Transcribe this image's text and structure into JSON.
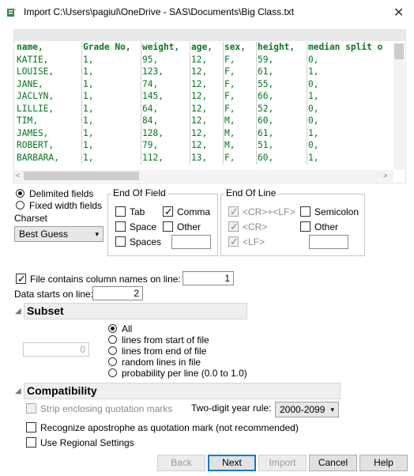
{
  "window": {
    "title": "Import C:\\Users\\pagiul\\OneDrive - SAS\\Documents\\Big Class.txt",
    "app_icon": "import-data-icon",
    "close_icon": "close-icon"
  },
  "preview": {
    "columns": [
      "name,",
      "Grade No,",
      "weight,",
      "age,",
      "sex,",
      "height,",
      "median split o"
    ],
    "rows": [
      [
        "KATIE,",
        "1,",
        "95,",
        "12,",
        "F,",
        "59,",
        "0,"
      ],
      [
        "LOUISE,",
        "1,",
        "123,",
        "12,",
        "F,",
        "61,",
        "1,"
      ],
      [
        "JANE,",
        "1,",
        "74,",
        "12,",
        "F,",
        "55,",
        "0,"
      ],
      [
        "JACLYN,",
        "1,",
        "145,",
        "12,",
        "F,",
        "66,",
        "1,"
      ],
      [
        "LILLIE,",
        "1,",
        "64,",
        "12,",
        "F,",
        "52,",
        "0,"
      ],
      [
        "TIM,",
        "1,",
        "84,",
        "12,",
        "M,",
        "60,",
        "0,"
      ],
      [
        "JAMES,",
        "1,",
        "128,",
        "12,",
        "M,",
        "61,",
        "1,"
      ],
      [
        "ROBERT,",
        "1,",
        "79,",
        "12,",
        "M,",
        "51,",
        "0,"
      ],
      [
        "BARBARA,",
        "1,",
        "112,",
        "13,",
        "F,",
        "60,",
        "1,"
      ]
    ],
    "text_color": "#007a1e"
  },
  "layout_mode": {
    "delimited_label": "Delimited fields",
    "fixed_label": "Fixed width fields",
    "selected": "delimited"
  },
  "charset": {
    "label": "Charset",
    "value": "Best Guess"
  },
  "end_of_field": {
    "title": "End Of Field",
    "tab": {
      "label": "Tab",
      "checked": false
    },
    "comma": {
      "label": "Comma",
      "checked": true
    },
    "space": {
      "label": "Space",
      "checked": false
    },
    "other": {
      "label": "Other",
      "checked": false
    },
    "spaces": {
      "label": "Spaces",
      "checked": false
    },
    "other_value": ""
  },
  "end_of_line": {
    "title": "End Of Line",
    "crlf": {
      "label": "<CR>+<LF>",
      "checked": true
    },
    "cr": {
      "label": "<CR>",
      "checked": true
    },
    "lf": {
      "label": "<LF>",
      "checked": true
    },
    "semicolon": {
      "label": "Semicolon",
      "checked": false
    },
    "other": {
      "label": "Other",
      "checked": false
    },
    "other_value": ""
  },
  "column_names": {
    "label": "File contains column names on line:",
    "checked": true,
    "value": "1"
  },
  "data_starts": {
    "label": "Data starts on line:",
    "value": "2"
  },
  "subset": {
    "title": "Subset",
    "count_value": "0",
    "options": [
      "All",
      "lines from start of file",
      "lines from end of file",
      "random lines in file",
      "probability per line (0.0 to 1.0)"
    ],
    "selected": "All"
  },
  "compatibility": {
    "title": "Compatibility",
    "strip_quotes": {
      "label": "Strip enclosing quotation marks",
      "checked": false
    },
    "year_rule_label": "Two-digit year rule:",
    "year_rule_value": "2000-2099",
    "apostrophe": {
      "label": "Recognize apostrophe as quotation mark (not recommended)",
      "checked": false
    },
    "regional": {
      "label": "Use Regional Settings",
      "checked": false
    }
  },
  "buttons": {
    "back": "Back",
    "next": "Next",
    "import": "Import",
    "cancel": "Cancel",
    "help": "Help"
  },
  "colors": {
    "default_button_border": "#0078d7",
    "section_header_bg": "#efefef"
  }
}
